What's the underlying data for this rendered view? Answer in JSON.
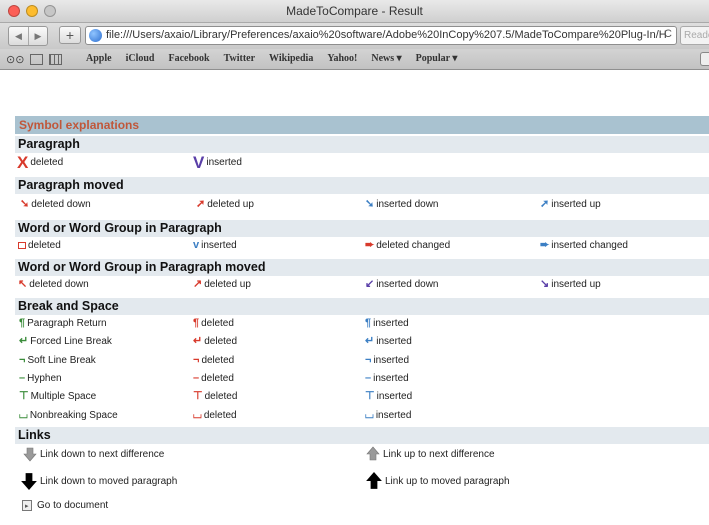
{
  "window": {
    "title": "MadeToCompare - Result",
    "url": "file:///Users/axaio/Library/Preferences/axaio%20software/Adobe%20InCopy%207.5/MadeToCompare%20Plug-In/H",
    "reload": "C",
    "reader": "Reader"
  },
  "bookmarks": [
    "Apple",
    "iCloud",
    "Facebook",
    "Twitter",
    "Wikipedia",
    "Yahoo!",
    "News ▾",
    "Popular ▾"
  ],
  "page": {
    "header": "Symbol explanations",
    "sections": {
      "paragraph": "Paragraph",
      "paragraph_moved": "Paragraph moved",
      "word": "Word or Word Group in Paragraph",
      "word_moved": "Word or Word Group in Paragraph moved",
      "break": "Break and Space",
      "links": "Links"
    },
    "paragraph": {
      "deleted": "deleted",
      "inserted": "inserted"
    },
    "paragraph_moved": {
      "deleted_down": "deleted down",
      "deleted_up": "deleted up",
      "inserted_down": "inserted down",
      "inserted_up": "inserted up"
    },
    "word": {
      "deleted": "deleted",
      "inserted": "inserted",
      "deleted_changed": "deleted changed",
      "inserted_changed": "inserted changed"
    },
    "word_moved": {
      "deleted_down": "deleted down",
      "deleted_up": "deleted up",
      "inserted_down": "inserted down",
      "inserted_up": "inserted up"
    },
    "break_rows": [
      {
        "name": "Paragraph Return",
        "deleted": "deleted",
        "inserted": "inserted",
        "glyph": "¶"
      },
      {
        "name": "Forced Line Break",
        "deleted": "deleted",
        "inserted": "inserted",
        "glyph": "↵"
      },
      {
        "name": "Soft Line Break",
        "deleted": "deleted",
        "inserted": "inserted",
        "glyph": "¬"
      },
      {
        "name": "Hyphen",
        "deleted": "deleted",
        "inserted": "inserted",
        "glyph": "–"
      },
      {
        "name": "Multiple Space",
        "deleted": "deleted",
        "inserted": "inserted",
        "glyph": "⊤"
      },
      {
        "name": "Nonbreaking Space",
        "deleted": "deleted",
        "inserted": "inserted",
        "glyph": "⌴"
      }
    ],
    "links": {
      "down_next": "Link down to next difference",
      "up_next": "Link up to next difference",
      "down_moved": "Link down to moved paragraph",
      "up_moved": "Link up to moved paragraph",
      "go_doc": "Go to document"
    }
  },
  "colors": {
    "deleted": "#d83a2c",
    "inserted": "#5a3fa8",
    "inserted_blue": "#3c7fc4",
    "header_bg": "#a9c2d0",
    "header_text": "#c0573a",
    "section_bg": "#e3e9ee"
  },
  "icons": {
    "back": "back-arrow-icon",
    "forward": "forward-arrow-icon",
    "add": "plus-icon",
    "globe": "globe-icon"
  }
}
